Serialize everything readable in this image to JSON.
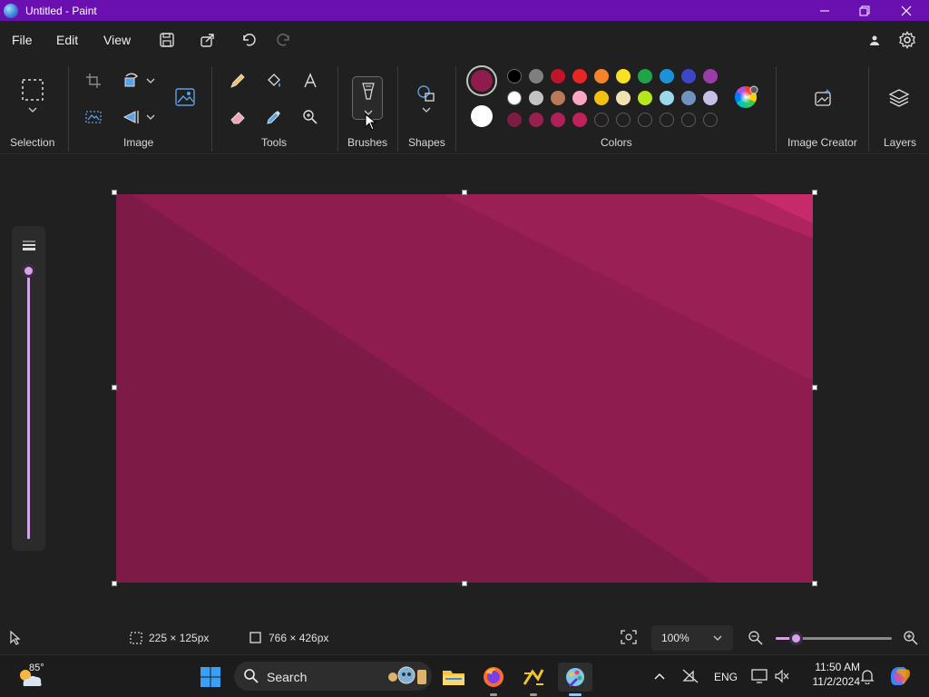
{
  "window": {
    "title": "Untitled - Paint"
  },
  "menu": {
    "file": "File",
    "edit": "Edit",
    "view": "View"
  },
  "ribbon": {
    "groups": {
      "selection": "Selection",
      "image": "Image",
      "tools": "Tools",
      "brushes": "Brushes",
      "shapes": "Shapes",
      "colors": "Colors",
      "image_creator": "Image Creator",
      "layers": "Layers"
    },
    "primary_color": "#8e1c4c",
    "secondary_color": "#ffffff",
    "palette": {
      "row1": [
        "#000000",
        "#7f7f7f",
        "#c0142b",
        "#ea2525",
        "#f5832b",
        "#f8e023",
        "#1ea646",
        "#1a93d8",
        "#3b47c5",
        "#9b3da9"
      ],
      "row2": [
        "#ffffff",
        "#c3c3c3",
        "#b97a57",
        "#f7a7c3",
        "#f2c011",
        "#efe4b0",
        "#b5e61d",
        "#99d9ea",
        "#7092be",
        "#c8bfe7"
      ],
      "row3": [
        "#7b1c43",
        "#962050",
        "#b02058",
        "#c1205c",
        "",
        "",
        "",
        "",
        "",
        ""
      ]
    }
  },
  "canvas": {
    "base_color": "#7e1a46",
    "stripe_colors": [
      "#8e1c4f",
      "#9a1f55",
      "#b0245e",
      "#c72a6a"
    ]
  },
  "statusbar": {
    "selection_size": "225 × 125px",
    "canvas_size": "766 × 426px",
    "zoom": "100%",
    "zoom_fraction": 0.17
  },
  "taskbar": {
    "weather_temp": "85°",
    "search_label": "Search",
    "language": "ENG",
    "time": "11:50 AM",
    "date": "11/2/2024"
  }
}
